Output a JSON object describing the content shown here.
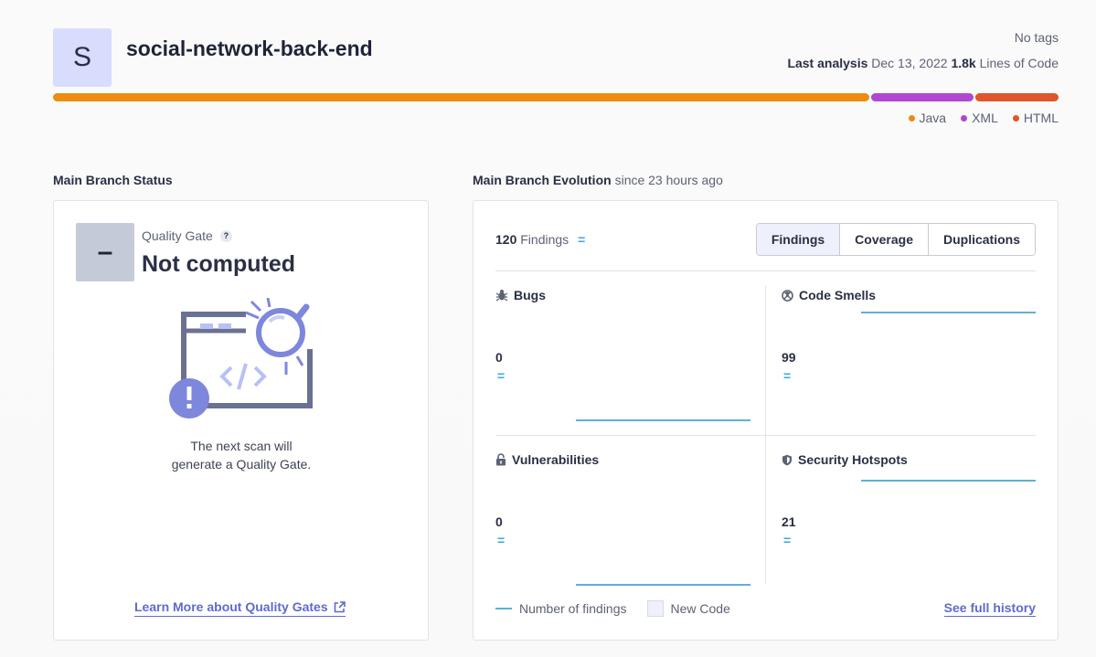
{
  "project": {
    "avatar_letter": "S",
    "name": "social-network-back-end",
    "tags": "No tags",
    "last_analysis_label": "Last analysis",
    "last_analysis_date": "Dec 13, 2022",
    "loc_value": "1.8k",
    "loc_label": "Lines of Code"
  },
  "languages": [
    {
      "name": "Java",
      "color": "#ed8c10",
      "share": 0.815
    },
    {
      "name": "XML",
      "color": "#b046d2",
      "share": 0.102
    },
    {
      "name": "HTML",
      "color": "#e0552b",
      "share": 0.083
    }
  ],
  "status": {
    "section_title": "Main Branch Status",
    "quality_gate_symbol": "–",
    "quality_gate_label": "Quality Gate",
    "help_symbol": "?",
    "quality_gate_status": "Not computed",
    "next_scan_text": "The next scan will generate a Quality Gate.",
    "learn_more": "Learn More about Quality Gates"
  },
  "evolution": {
    "section_title": "Main Branch Evolution",
    "since": "since 23 hours ago",
    "findings_count": "120",
    "findings_label": "Findings",
    "equal_symbol": "=",
    "tabs": [
      "Findings",
      "Coverage",
      "Duplications"
    ],
    "active_tab": "Findings",
    "metrics": {
      "bugs": {
        "label": "Bugs",
        "value": "0"
      },
      "code_smells": {
        "label": "Code Smells",
        "value": "99"
      },
      "vulnerabilities": {
        "label": "Vulnerabilities",
        "value": "0"
      },
      "security_hotspots": {
        "label": "Security Hotspots",
        "value": "21"
      }
    },
    "legend_findings": "Number of findings",
    "legend_new_code": "New Code",
    "see_full_history": "See full history"
  },
  "colors": {
    "accent": "#5e6bce",
    "trend_line": "#62aed9",
    "equal_sign": "#3ca6dd"
  }
}
